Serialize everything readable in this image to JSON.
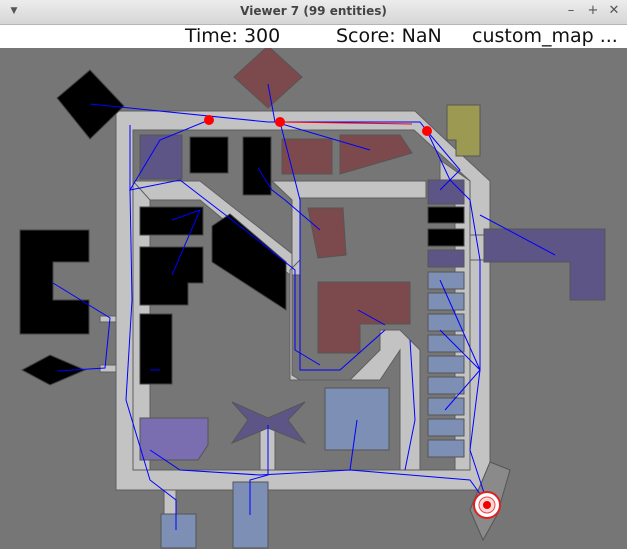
{
  "window": {
    "title": "Viewer 7 (99 entities)",
    "menu_icon": "chevron-down-icon",
    "minimize_glyph": "–",
    "maximize_glyph": "+",
    "close_glyph": "✕"
  },
  "status": {
    "time_text": "Time: 300",
    "score_text": "Score: NaN",
    "map_text": "custom_map ..."
  },
  "colors": {
    "background": "#767676",
    "corridor": "#c4c4c4",
    "room_dark": "#000000",
    "room_red": "#7c4a4c",
    "room_purple": "#5e5587",
    "room_blue": "#7d8fb4",
    "room_olive": "#9c9a52",
    "path": "#0000ff",
    "agent": "#ff0000"
  },
  "entities": {
    "agents_red": 4,
    "goal_marker": "target-icon"
  }
}
